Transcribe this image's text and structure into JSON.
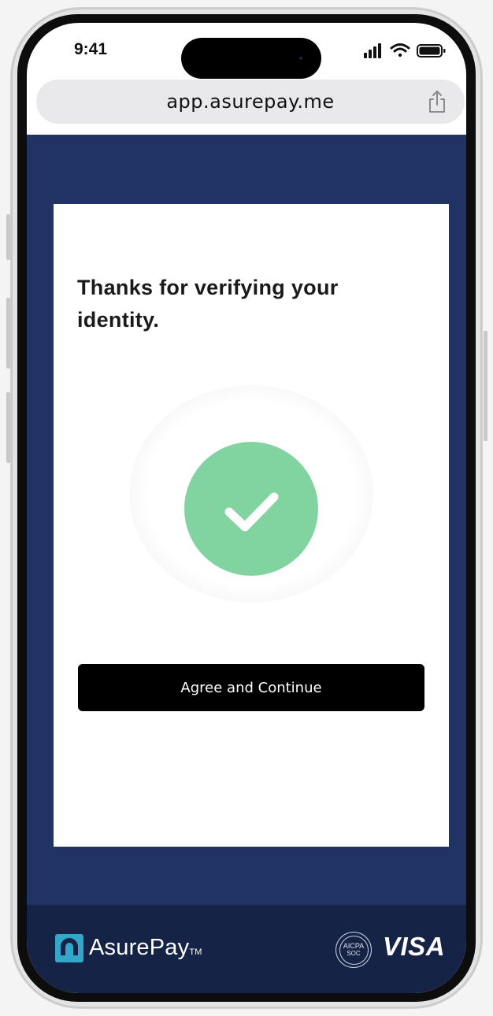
{
  "status_bar": {
    "time": "9:41"
  },
  "browser": {
    "url": "app.asurepay.me",
    "share_icon": "share-icon"
  },
  "card": {
    "heading": "Thanks for verifying your identity.",
    "status_icon": "checkmark-icon",
    "button_label": "Agree and Continue"
  },
  "footer": {
    "brand_name": "AsurePay",
    "brand_tm": "TM",
    "badge_line1": "AICPA",
    "badge_line2": "SOC",
    "card_network": "VISA"
  },
  "colors": {
    "page_background": "#213264",
    "footer_background": "#152346",
    "success_green": "#81d4a0",
    "button_background": "#000000"
  }
}
